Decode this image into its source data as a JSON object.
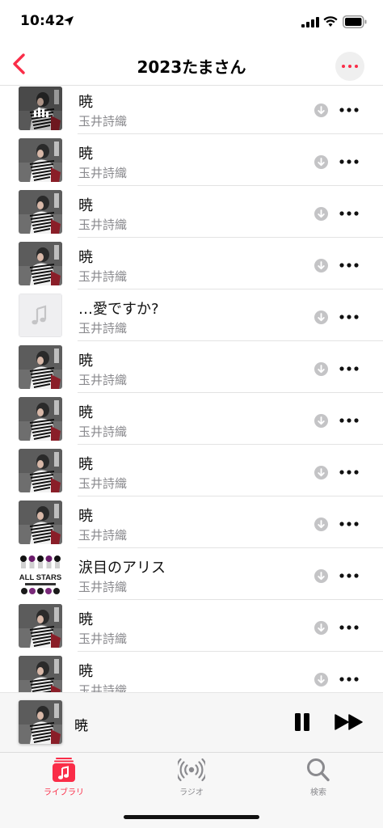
{
  "status_bar": {
    "time": "10:42"
  },
  "nav": {
    "title": "2023たまさん"
  },
  "songs": [
    {
      "title": "暁",
      "artist": "玉井詩織",
      "art": "tamai",
      "playing": true
    },
    {
      "title": "暁",
      "artist": "玉井詩織",
      "art": "tamai"
    },
    {
      "title": "暁",
      "artist": "玉井詩織",
      "art": "tamai"
    },
    {
      "title": "暁",
      "artist": "玉井詩織",
      "art": "tamai"
    },
    {
      "title": "…愛ですか?",
      "artist": "玉井詩織",
      "art": "placeholder"
    },
    {
      "title": "暁",
      "artist": "玉井詩織",
      "art": "tamai"
    },
    {
      "title": "暁",
      "artist": "玉井詩織",
      "art": "tamai"
    },
    {
      "title": "暁",
      "artist": "玉井詩織",
      "art": "tamai"
    },
    {
      "title": "暁",
      "artist": "玉井詩織",
      "art": "tamai"
    },
    {
      "title": "涙目のアリス",
      "artist": "玉井詩織",
      "art": "allstars",
      "art_text": "ALL STARS"
    },
    {
      "title": "暁",
      "artist": "玉井詩織",
      "art": "tamai"
    },
    {
      "title": "暁",
      "artist": "玉井詩織",
      "art": "tamai"
    }
  ],
  "now_playing": {
    "title": "暁"
  },
  "tabs": [
    {
      "label": "ライブラリ",
      "icon": "library-icon",
      "active": true
    },
    {
      "label": "ラジオ",
      "icon": "radio-icon"
    },
    {
      "label": "検索",
      "icon": "search-icon"
    }
  ],
  "colors": {
    "accent": "#fa2d48",
    "secondary_text": "#8a8a8e",
    "icon_gray": "#c4c4c6"
  }
}
